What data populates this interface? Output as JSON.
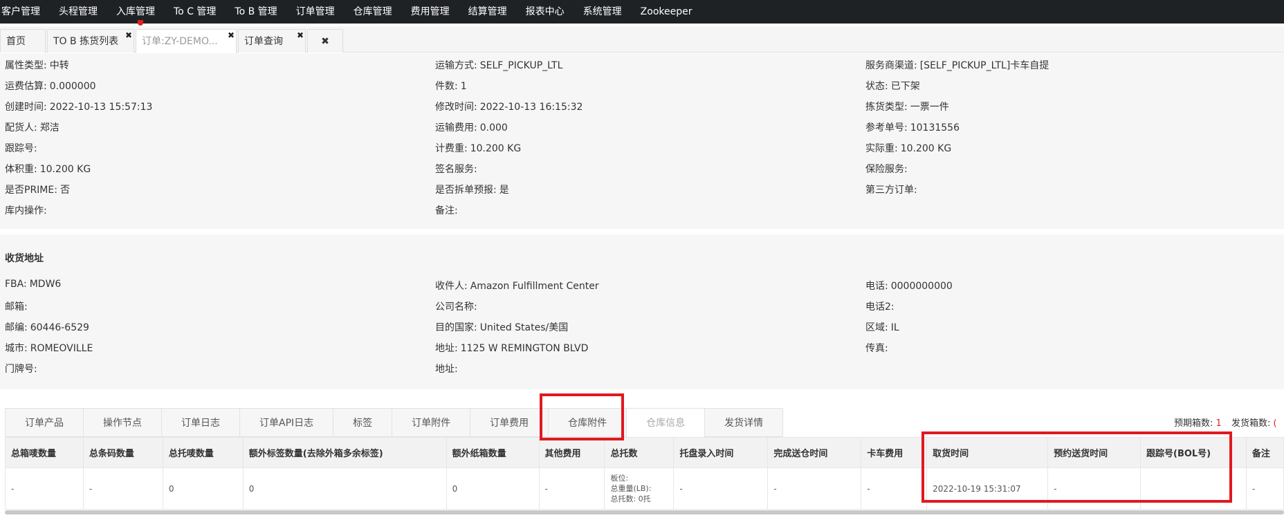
{
  "topnav": [
    "客户管理",
    "头程管理",
    "入库管理",
    "To C 管理",
    "To B 管理",
    "订单管理",
    "仓库管理",
    "费用管理",
    "结算管理",
    "报表中心",
    "系统管理",
    "Zookeeper"
  ],
  "tabs": [
    {
      "label": "首页",
      "close": ""
    },
    {
      "label": "TO B 拣货列表",
      "close": "✖"
    },
    {
      "label": "订单:ZY-DEMO...",
      "close": "✖"
    },
    {
      "label": "订单查询",
      "close": "✖"
    },
    {
      "label": "✖",
      "close": ""
    }
  ],
  "order_info": {
    "col1": [
      {
        "label": "属性类型:",
        "value": "中转"
      },
      {
        "label": "运费估算:",
        "value": "0.000000"
      },
      {
        "label": "创建时间:",
        "value": "2022-10-13 15:57:13"
      },
      {
        "label": "配货人:",
        "value": "郑洁"
      },
      {
        "label": "跟踪号:",
        "value": ""
      },
      {
        "label": "体积重:",
        "value": "10.200 KG"
      },
      {
        "label": "是否PRIME:",
        "value": "否"
      },
      {
        "label": "库内操作:",
        "value": ""
      }
    ],
    "col2": [
      {
        "label": "运输方式:",
        "value": "SELF_PICKUP_LTL"
      },
      {
        "label": "件数:",
        "value": "1"
      },
      {
        "label": "修改时间:",
        "value": "2022-10-13 16:15:32"
      },
      {
        "label": "运输费用:",
        "value": "0.000"
      },
      {
        "label": "计费重:",
        "value": "10.200 KG"
      },
      {
        "label": "签名服务:",
        "value": ""
      },
      {
        "label": "是否拆单预报:",
        "value": "是"
      },
      {
        "label": "备注:",
        "value": ""
      }
    ],
    "col3": [
      {
        "label": "服务商渠道:",
        "value": "[SELF_PICKUP_LTL]卡车自提"
      },
      {
        "label": "状态:",
        "value": "已下架"
      },
      {
        "label": "拣货类型:",
        "value": "一票一件"
      },
      {
        "label": "参考单号:",
        "value": "10131556"
      },
      {
        "label": "实际重:",
        "value": "10.200 KG"
      },
      {
        "label": "保险服务:",
        "value": ""
      },
      {
        "label": "第三方订单:",
        "value": ""
      }
    ]
  },
  "address": {
    "title": "收货地址",
    "col1": [
      {
        "label": "FBA:",
        "value": "MDW6"
      },
      {
        "label": "邮箱:",
        "value": ""
      },
      {
        "label": "邮编:",
        "value": "60446-6529"
      },
      {
        "label": "城市:",
        "value": "ROMEOVILLE"
      },
      {
        "label": "门牌号:",
        "value": ""
      }
    ],
    "col2": [
      {
        "label": "收件人:",
        "value": "Amazon Fulfillment Center"
      },
      {
        "label": "公司名称:",
        "value": ""
      },
      {
        "label": "目的国家:",
        "value": "United States/美国"
      },
      {
        "label": "地址:",
        "value": "1125 W REMINGTON BLVD"
      },
      {
        "label": "地址:",
        "value": ""
      }
    ],
    "col3": [
      {
        "label": "电话:",
        "value": "0000000000"
      },
      {
        "label": "电话2:",
        "value": ""
      },
      {
        "label": "区域:",
        "value": "IL"
      },
      {
        "label": "传真:",
        "value": ""
      }
    ]
  },
  "bottom_tabs": [
    "订单产品",
    "操作节点",
    "订单日志",
    "订单API日志",
    "标签",
    "订单附件",
    "订单费用",
    "仓库附件",
    "仓库信息",
    "发货详情"
  ],
  "active_bottom_tab": 8,
  "summary": {
    "expected_label": "预期箱数:",
    "expected_value": "1",
    "shipped_label": "发货箱数:",
    "shipped_value": "("
  },
  "table": {
    "headers": [
      "总箱唛数量",
      "总条码数量",
      "总托唛数量",
      "额外标签数量(去除外箱多余标签)",
      "额外纸箱数量",
      "其他费用",
      "总托数",
      "托盘录入时间",
      "完成送仓时间",
      "卡车费用",
      "取货时间",
      "预约送货时间",
      "跟踪号(BOL号)",
      "备注"
    ],
    "row": [
      "-",
      "-",
      "0",
      "0",
      "0",
      "-",
      "",
      "-",
      "-",
      "-",
      "2022-10-19 15:31:07",
      "-",
      "",
      "-"
    ],
    "pallet_lines": [
      "板位:",
      "总重量(LB):",
      "总托数: 0托"
    ]
  }
}
